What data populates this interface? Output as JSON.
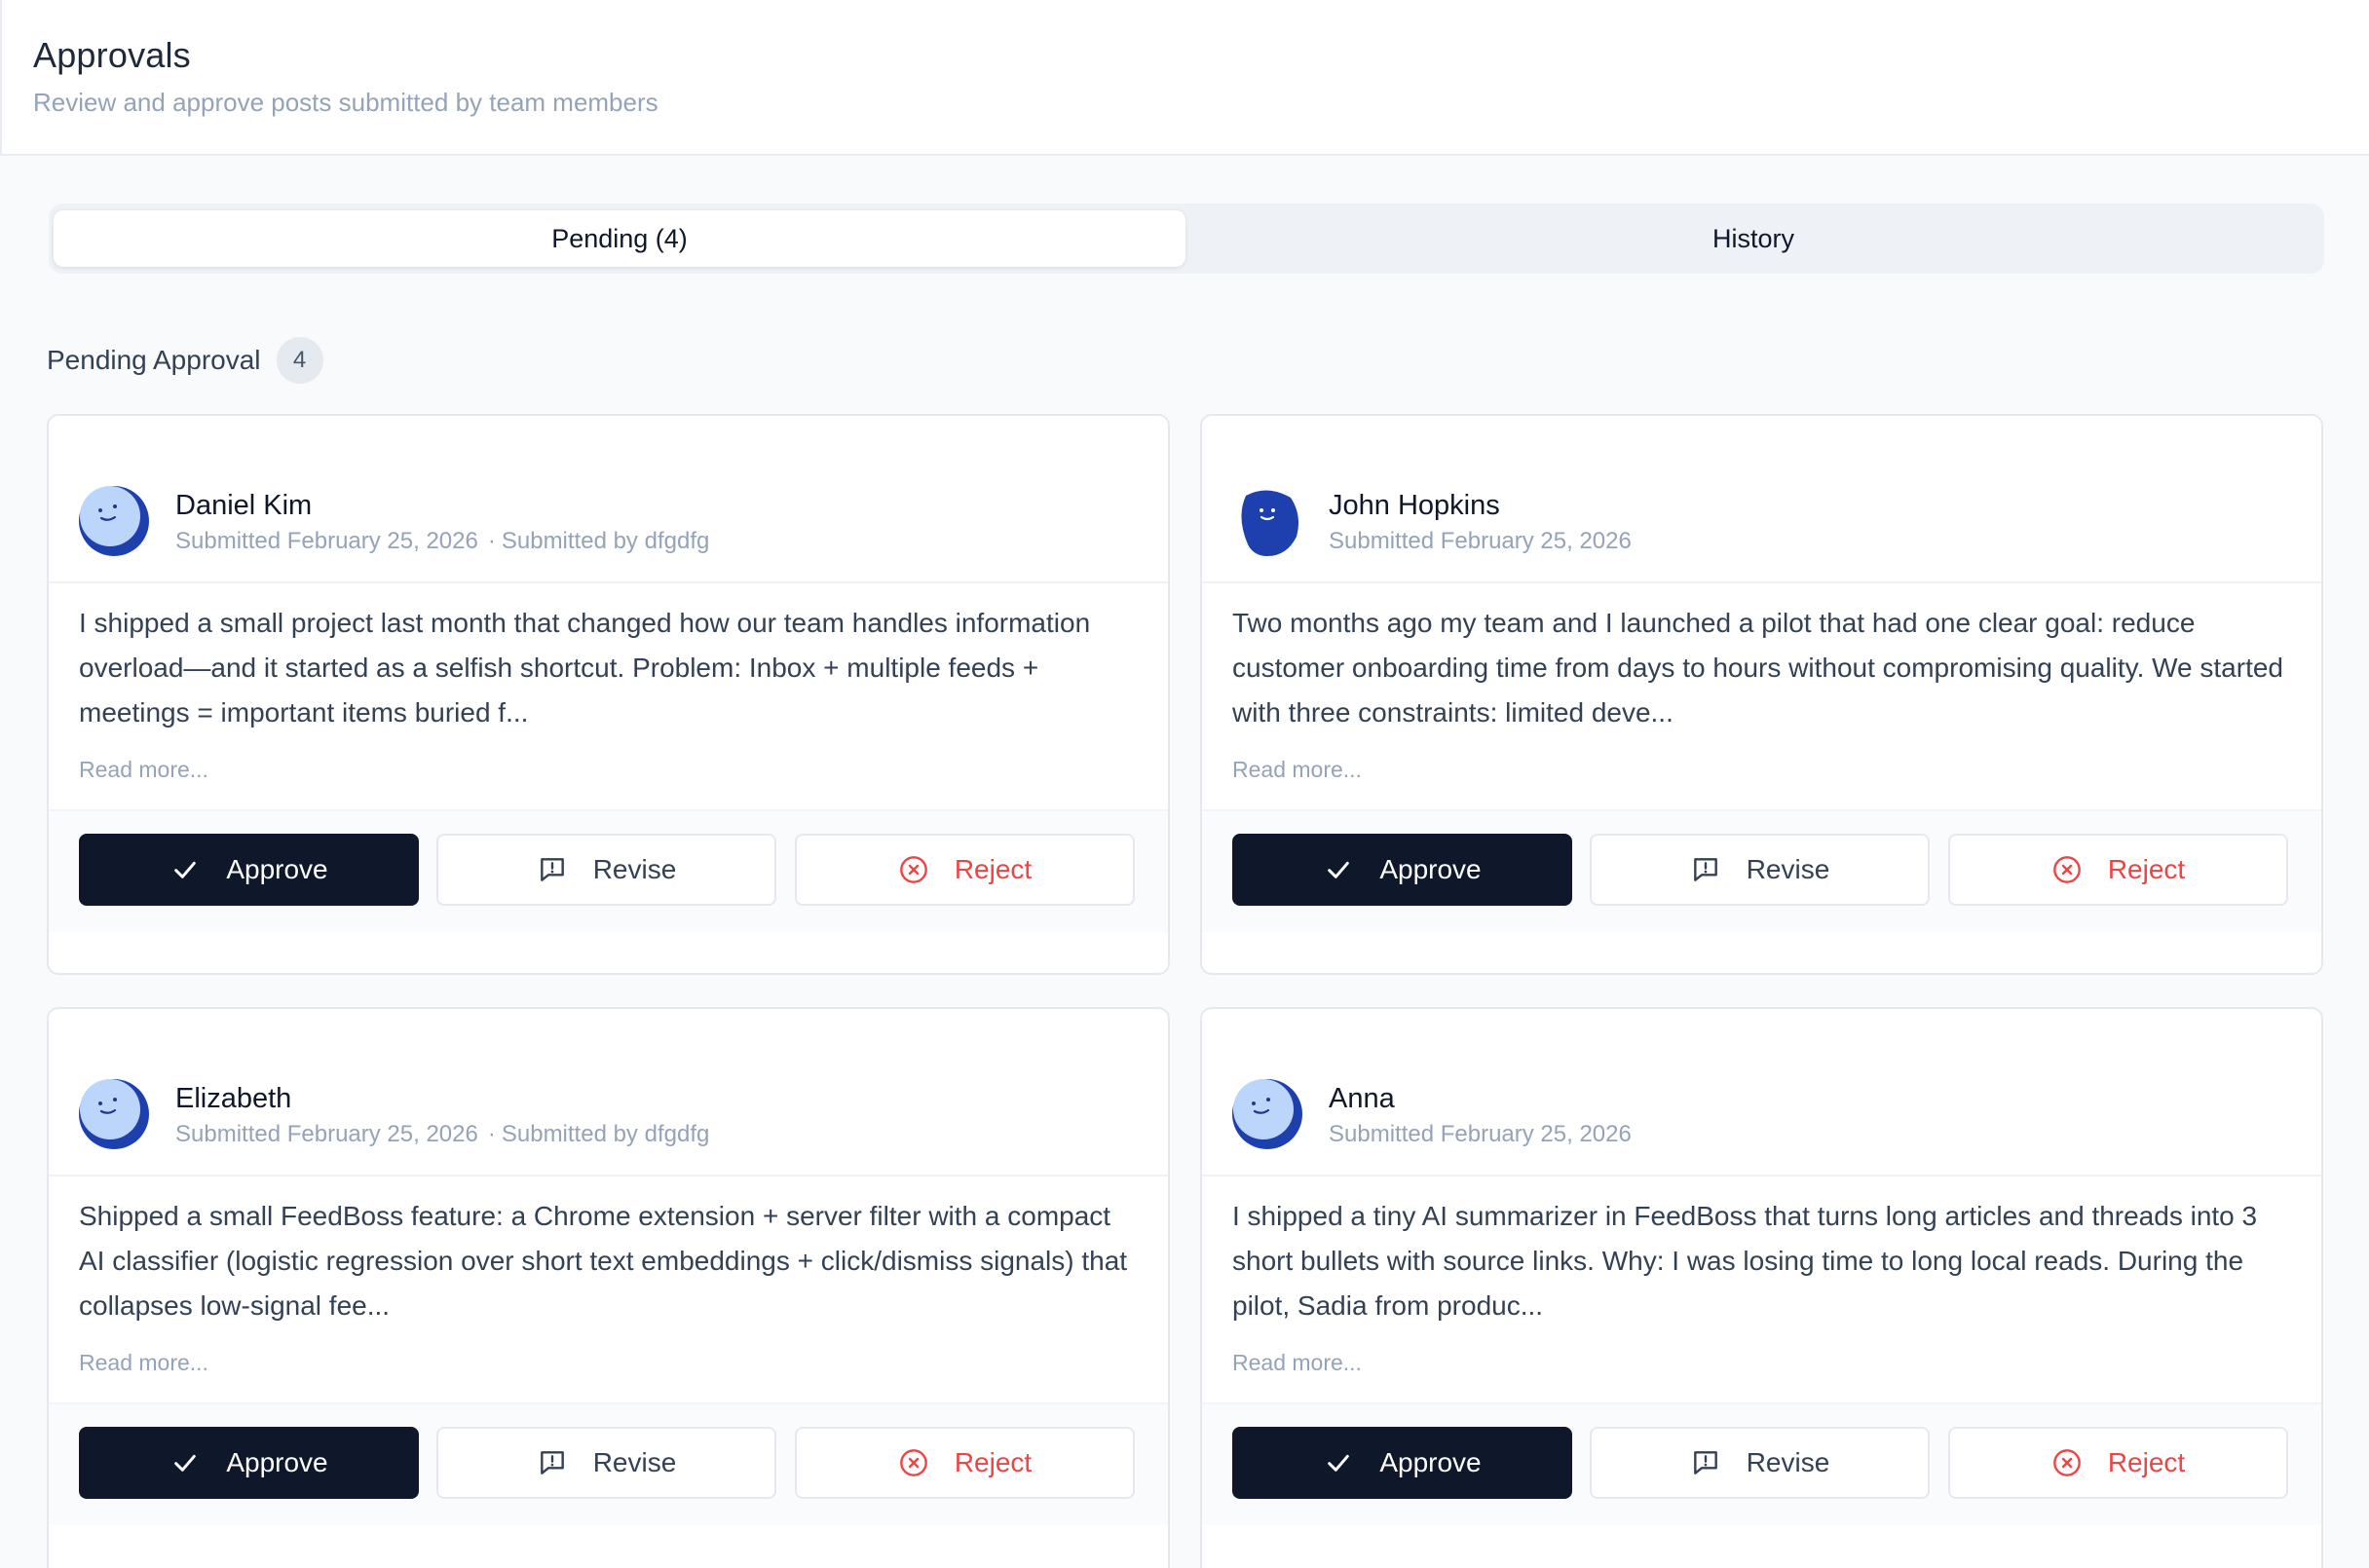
{
  "header": {
    "title": "Approvals",
    "subtitle": "Review and approve posts submitted by team members"
  },
  "tabs": [
    {
      "label": "Pending (4)",
      "active": true
    },
    {
      "label": "History",
      "active": false
    }
  ],
  "section": {
    "title": "Pending Approval",
    "count": "4"
  },
  "colors": {
    "primary_button": "#0f172a",
    "reject": "#ef4444",
    "avatar_light": "#bcd6fb",
    "avatar_dark": "#1e40af"
  },
  "posts": [
    {
      "author": "Daniel Kim",
      "submitted": "Submitted February 25, 2026",
      "submitted_by": "Submitted by dfgdfg",
      "avatar_icon": "smiley-moon-avatar-light",
      "excerpt": "I shipped a small project last month that changed how our team handles information overload—and it started as a selfish shortcut. Problem: Inbox + multiple feeds + meetings = important items buried f...",
      "read_more": "Read more...",
      "approve_label": "Approve",
      "revise_label": "Revise",
      "reject_label": "Reject"
    },
    {
      "author": "John Hopkins",
      "submitted": "Submitted February 25, 2026",
      "submitted_by": "",
      "avatar_icon": "smiley-blob-avatar-dark",
      "excerpt": "Two months ago my team and I launched a pilot that had one clear goal: reduce customer onboarding time from days to hours without compromising quality. We started with three constraints: limited deve...",
      "read_more": "Read more...",
      "approve_label": "Approve",
      "revise_label": "Revise",
      "reject_label": "Reject"
    },
    {
      "author": "Elizabeth",
      "submitted": "Submitted February 25, 2026",
      "submitted_by": "Submitted by dfgdfg",
      "avatar_icon": "smiley-moon-avatar-light",
      "excerpt": "Shipped a small FeedBoss feature: a Chrome extension + server filter with a compact AI classifier (logistic regression over short text embeddings + click/dismiss signals) that collapses low-signal fee...",
      "read_more": "Read more...",
      "approve_label": "Approve",
      "revise_label": "Revise",
      "reject_label": "Reject"
    },
    {
      "author": "Anna",
      "submitted": "Submitted February 25, 2026",
      "submitted_by": "",
      "avatar_icon": "smiley-moon-avatar-light",
      "excerpt": "I shipped a tiny AI summarizer in FeedBoss that turns long articles and threads into 3 short bullets with source links. Why: I was losing time to long local reads. During the pilot, Sadia from produc...",
      "read_more": "Read more...",
      "approve_label": "Approve",
      "revise_label": "Revise",
      "reject_label": "Reject"
    }
  ]
}
